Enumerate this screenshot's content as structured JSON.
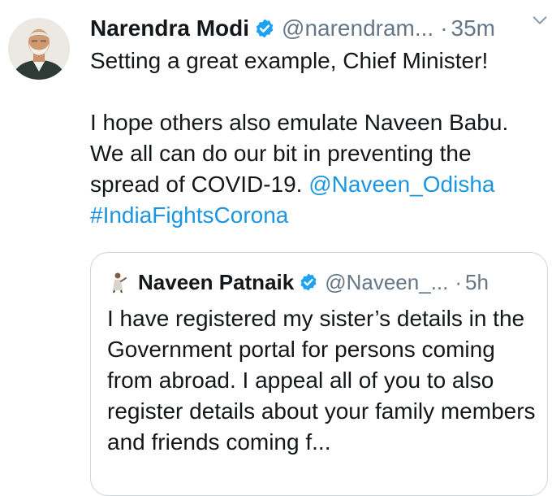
{
  "tweet": {
    "author_name": "Narendra Modi",
    "author_handle": "@narendram...",
    "separator": "·",
    "time": "35m",
    "lines": [
      "Setting a great example, Chief Minister!",
      "",
      "I hope others also emulate Naveen Babu.",
      "We all can do our bit in preventing the"
    ],
    "last_line_text": "spread of COVID-19. ",
    "mention": "@Naveen_Odisha",
    "hashtag": "#IndiaFightsCorona"
  },
  "quoted_tweet": {
    "author_name": "Naveen Patnaik",
    "author_handle": "@Naveen_...",
    "separator": "·",
    "time": "5h",
    "text": "I have registered my sister’s details in the Government portal for persons coming from abroad. I appeal all of you to also register details about your family members and friends coming f..."
  },
  "icons": {
    "verified": "verified-badge-icon",
    "menu": "chevron-down-icon",
    "avatar": "avatar-image"
  },
  "colors": {
    "link": "#1b95e0",
    "muted": "#657786",
    "text": "#14171a",
    "verified": "#1da1f2",
    "border": "#ccd6dd"
  }
}
